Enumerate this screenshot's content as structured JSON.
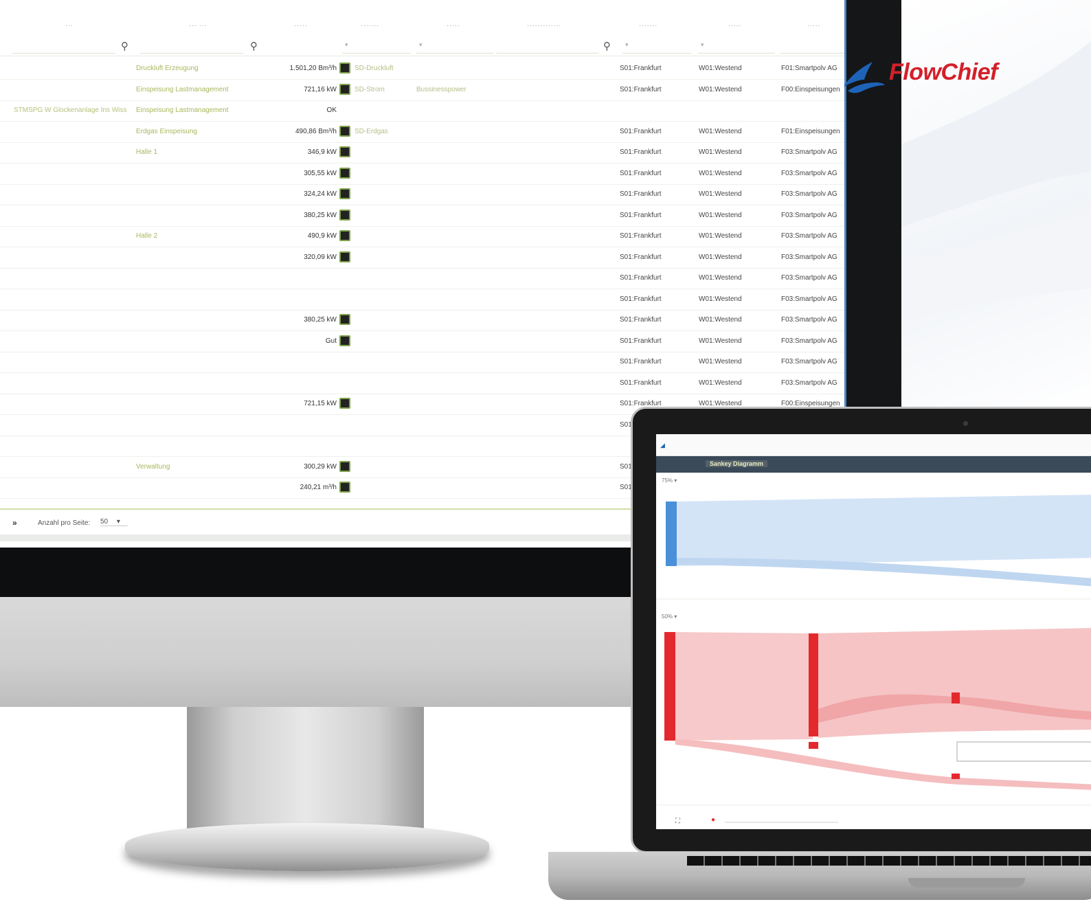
{
  "brand": {
    "name": "FlowChief",
    "color": "#d3202a"
  },
  "table": {
    "rows": [
      {
        "name": "Druckluft Erzeugung",
        "value": "1.501,20 Bm³/h",
        "dev": "SD-Druckluft",
        "type": "",
        "proc": "",
        "loc": "S01:Frankfurt",
        "area": "W01:Westend",
        "comp": "F01:Smartpolv AG"
      },
      {
        "name": "Einspeisung Lastmanagement",
        "value": "721,16 kW",
        "dev": "SD-Strom",
        "type": "Bussinesspower",
        "proc": "",
        "loc": "S01:Frankfurt",
        "area": "W01:Westend",
        "comp": "F00:Einspeisungen"
      },
      {
        "id": "STMSPG W Glockenanlage Ins Wiss",
        "name": "Einspeisung Lastmanagement",
        "value": "OK",
        "dev": "",
        "type": "",
        "proc": "",
        "loc": "",
        "area": "",
        "comp": ""
      },
      {
        "name": "Erdgas Einspeisung",
        "value": "490,86 Bm³/h",
        "dev": "SD-Erdgas",
        "type": "",
        "proc": "",
        "loc": "S01:Frankfurt",
        "area": "W01:Westend",
        "comp": "F01:Einspeisungen"
      },
      {
        "name": "Halle 1",
        "value": "346,9 kW",
        "dev": "",
        "type": "",
        "proc": "",
        "loc": "S01:Frankfurt",
        "area": "W01:Westend",
        "comp": "F03:Smartpolv AG"
      },
      {
        "name": "",
        "value": "305,55 kW",
        "dev": "",
        "type": "",
        "proc": "",
        "loc": "S01:Frankfurt",
        "area": "W01:Westend",
        "comp": "F03:Smartpolv AG"
      },
      {
        "name": "",
        "value": "324,24 kW",
        "dev": "",
        "type": "",
        "proc": "",
        "loc": "S01:Frankfurt",
        "area": "W01:Westend",
        "comp": "F03:Smartpolv AG"
      },
      {
        "name": "",
        "value": "380,25 kW",
        "dev": "",
        "type": "",
        "proc": "",
        "loc": "S01:Frankfurt",
        "area": "W01:Westend",
        "comp": "F03:Smartpolv AG"
      },
      {
        "name": "Halle 2",
        "value": "490,9 kW",
        "dev": "",
        "type": "",
        "proc": "",
        "loc": "S01:Frankfurt",
        "area": "W01:Westend",
        "comp": "F03:Smartpolv AG"
      },
      {
        "name": "",
        "value": "320,09 kW",
        "dev": "",
        "type": "",
        "proc": "",
        "loc": "S01:Frankfurt",
        "area": "W01:Westend",
        "comp": "F03:Smartpolv AG"
      },
      {
        "name": "",
        "value": "",
        "dev": "",
        "type": "",
        "proc": "",
        "loc": "S01:Frankfurt",
        "area": "W01:Westend",
        "comp": "F03:Smartpolv AG"
      },
      {
        "name": "",
        "value": "",
        "dev": "",
        "type": "",
        "proc": "",
        "loc": "S01:Frankfurt",
        "area": "W01:Westend",
        "comp": "F03:Smartpolv AG"
      },
      {
        "name": "",
        "value": "380,25 kW",
        "dev": "",
        "type": "",
        "proc": "",
        "loc": "S01:Frankfurt",
        "area": "W01:Westend",
        "comp": "F03:Smartpolv AG"
      },
      {
        "name": "",
        "value": "Gut",
        "dev": "",
        "type": "",
        "proc": "",
        "loc": "S01:Frankfurt",
        "area": "W01:Westend",
        "comp": "F03:Smartpolv AG"
      },
      {
        "name": "",
        "value": "",
        "dev": "",
        "type": "",
        "proc": "",
        "loc": "S01:Frankfurt",
        "area": "W01:Westend",
        "comp": "F03:Smartpolv AG"
      },
      {
        "name": "",
        "value": "",
        "dev": "",
        "type": "",
        "proc": "",
        "loc": "S01:Frankfurt",
        "area": "W01:Westend",
        "comp": "F03:Smartpolv AG"
      },
      {
        "name": "",
        "value": "721,15 kW",
        "dev": "",
        "type": "",
        "proc": "",
        "loc": "S01:Frankfurt",
        "area": "W01:Westend",
        "comp": "F00:Einspeisungen"
      },
      {
        "name": "",
        "value": "",
        "dev": "",
        "type": "",
        "proc": "",
        "loc": "S01",
        "area": "",
        "comp": ""
      },
      {
        "name": "",
        "value": "",
        "dev": "",
        "type": "",
        "proc": "",
        "loc": "",
        "area": "",
        "comp": ""
      },
      {
        "name": "Verwaltung",
        "value": "300,29 kW",
        "dev": "",
        "type": "",
        "proc": "",
        "loc": "S01",
        "area": "",
        "comp": ""
      },
      {
        "name": "",
        "value": "240,21 m³/h",
        "dev": "",
        "type": "",
        "proc": "",
        "loc": "S01",
        "area": "",
        "comp": ""
      }
    ]
  },
  "pager": {
    "label": "Anzahl pro Seite:",
    "page_size": "50"
  },
  "laptop": {
    "tabs": [
      "",
      "Sankey Diagramm"
    ],
    "zoom_a": "75%",
    "zoom_b": "50%",
    "colors": {
      "blue": "#4a90d9",
      "red": "#e3292e"
    }
  }
}
